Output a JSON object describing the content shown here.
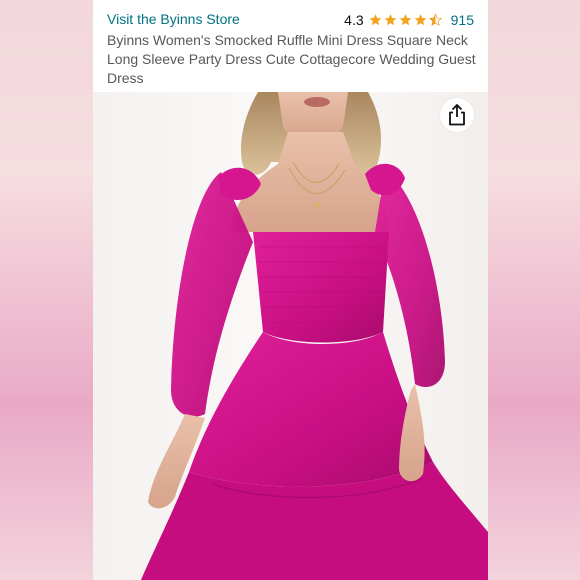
{
  "product": {
    "store_link": "Visit the Byinns Store",
    "rating_value": "4.3",
    "rating_fraction": 0.86,
    "rating_count": "915",
    "title": "Byinns Women's Smocked Ruffle Mini Dress Square Neck Long Sleeve Party Dress Cute Cottagecore Wedding Guest Dress"
  },
  "icons": {
    "share": "share-icon",
    "star": "star-icon"
  },
  "colors": {
    "link": "#007185",
    "star": "#f4a41c",
    "dress": "#d1148c",
    "text": "#0f1111",
    "title": "#565959"
  }
}
